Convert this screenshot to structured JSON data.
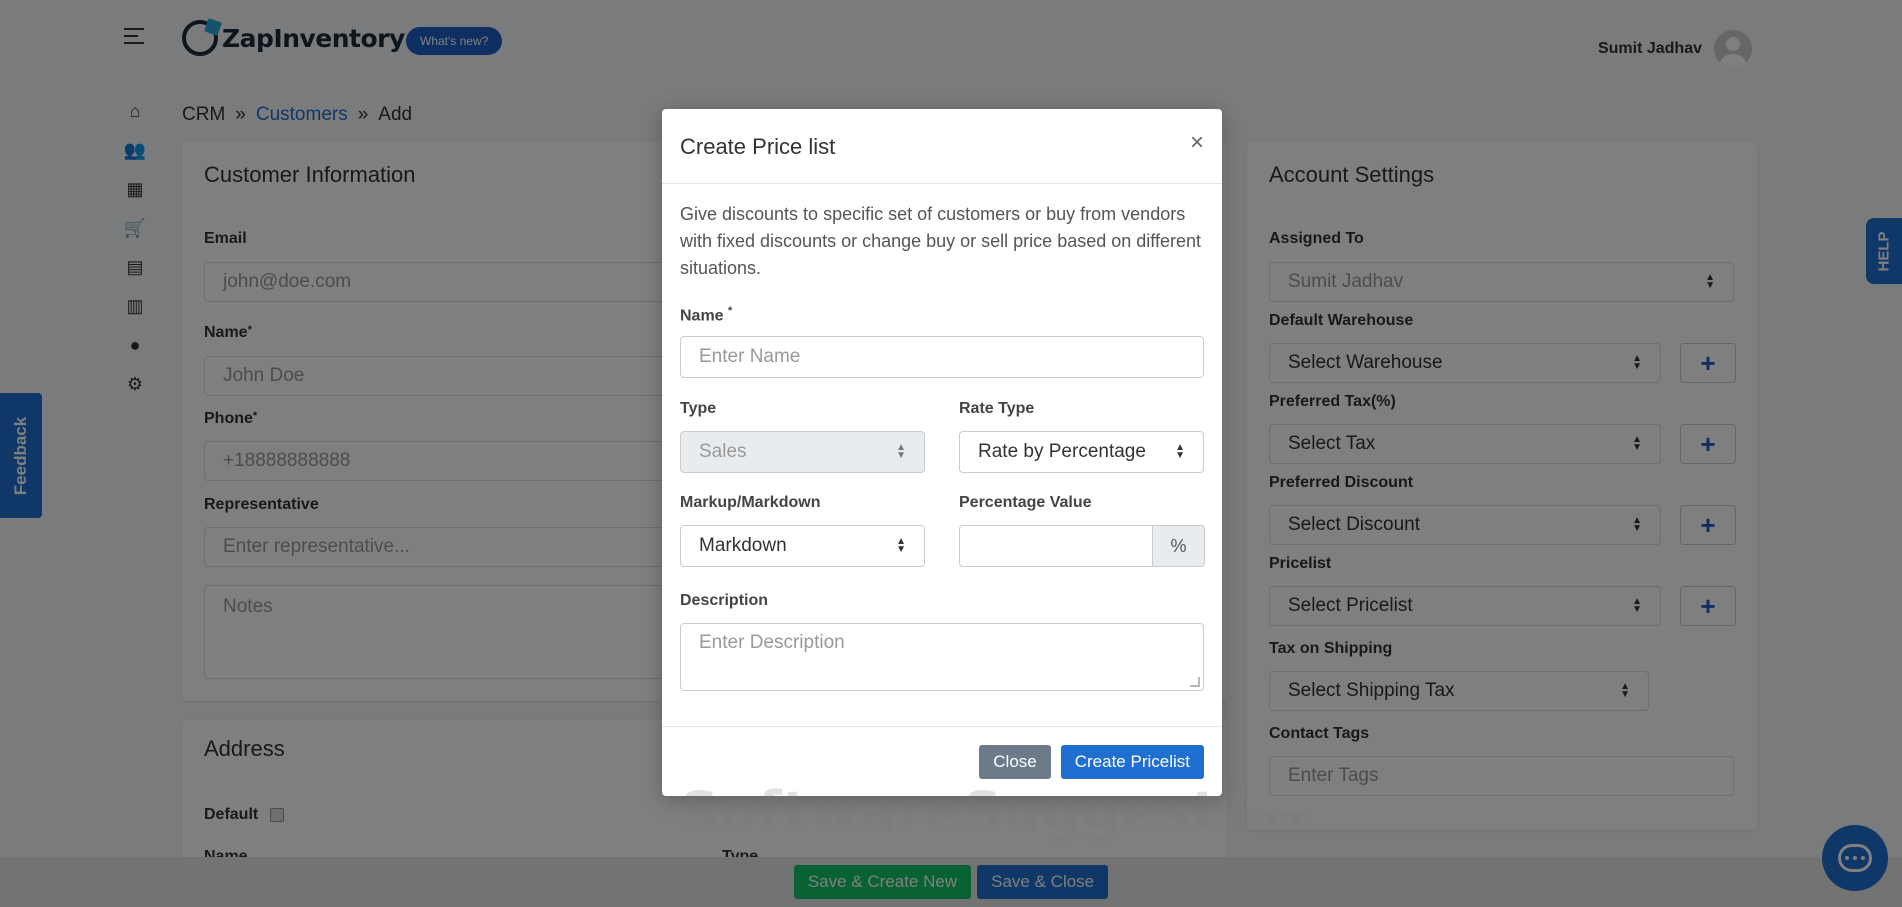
{
  "header": {
    "logo_text": "ZapInventory",
    "whats_new": "What's new?",
    "user_name": "Sumit Jadhav"
  },
  "breadcrumb": {
    "crm": "CRM",
    "sep1": "»",
    "customers": "Customers",
    "sep2": "»",
    "add": "Add"
  },
  "customer_info": {
    "title": "Customer Information",
    "email_label": "Email",
    "email_placeholder": "john@doe.com",
    "name_label": "Name",
    "name_placeholder": "John Doe",
    "phone_label": "Phone",
    "phone_placeholder": "+18888888888",
    "rep_label": "Representative",
    "rep_placeholder": "Enter representative...",
    "notes_placeholder": "Notes",
    "required_mark": "*"
  },
  "address": {
    "title": "Address",
    "default_label": "Default",
    "name_label": "Name",
    "type_label": "Type"
  },
  "account_settings": {
    "title": "Account Settings",
    "assigned_label": "Assigned To",
    "assigned_value": "Sumit Jadhav",
    "warehouse_label": "Default Warehouse",
    "warehouse_value": "Select Warehouse",
    "tax_label": "Preferred Tax(%)",
    "tax_value": "Select Tax",
    "discount_label": "Preferred Discount",
    "discount_value": "Select Discount",
    "pricelist_label": "Pricelist",
    "pricelist_value": "Select Pricelist",
    "shipping_label": "Tax on Shipping",
    "shipping_value": "Select Shipping Tax",
    "tags_label": "Contact Tags",
    "tags_placeholder": "Enter Tags",
    "plus": "+"
  },
  "side_tabs": {
    "feedback": "Feedback",
    "help": "HELP"
  },
  "footer": {
    "save_new": "Save & Create New",
    "save_close": "Save & Close"
  },
  "modal": {
    "title": "Create Price list",
    "close_x": "×",
    "description": "Give discounts to specific set of customers or buy from vendors with fixed discounts or change buy or sell price based on different situations.",
    "name_label": "Name",
    "required_mark": "*",
    "name_placeholder": "Enter Name",
    "type_label": "Type",
    "type_value": "Sales",
    "rate_type_label": "Rate Type",
    "rate_type_value": "Rate by Percentage",
    "markup_label": "Markup/Markdown",
    "markup_value": "Markdown",
    "pct_label": "Percentage Value",
    "pct_value": "",
    "pct_addon": "%",
    "desc_label": "Description",
    "desc_placeholder": "Enter Description",
    "close_btn": "Close",
    "create_btn": "Create Pricelist"
  },
  "watermark": {
    "main": "SoftwareSuggest",
    "suffix": ".com"
  }
}
